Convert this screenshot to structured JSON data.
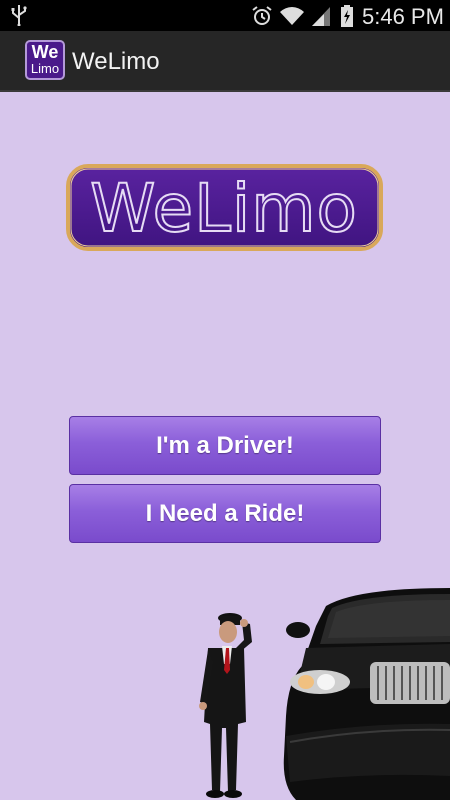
{
  "status_bar": {
    "time": "5:46 PM",
    "icons": [
      "usb-icon",
      "alarm-icon",
      "wifi-icon",
      "signal-icon",
      "battery-icon"
    ]
  },
  "action_bar": {
    "icon_line1": "We",
    "icon_line2": "Limo",
    "title": "WeLimo"
  },
  "logo": {
    "text": "WeLimo"
  },
  "buttons": {
    "driver": "I'm a Driver!",
    "ride": "I Need a Ride!"
  },
  "colors": {
    "background": "#d7c6ec",
    "button": "#8b5fd9",
    "logo_fill": "#4a1a8a",
    "logo_border": "#d9a85a"
  }
}
